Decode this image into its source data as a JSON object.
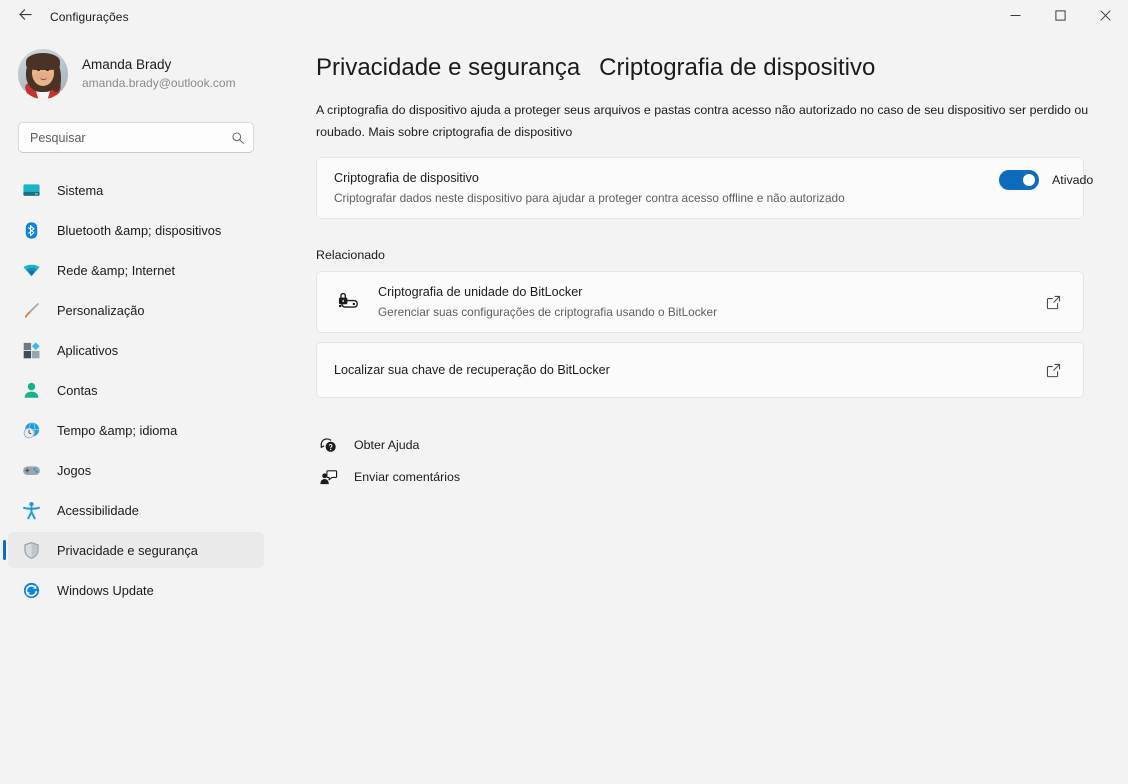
{
  "window": {
    "title": "Configurações",
    "back_icon": "back-arrow-icon",
    "minimize_label": "Minimizar",
    "maximize_label": "Maximizar",
    "close_label": "Fechar"
  },
  "account": {
    "name": "Amanda Brady",
    "email": "amanda.brady@outlook.com",
    "avatar_alt": "Amanda Brady"
  },
  "search": {
    "placeholder": "Pesquisar",
    "value": "",
    "icon": "search-icon"
  },
  "sidebar": {
    "items": [
      {
        "label": "Sistema",
        "icon": "monitor-icon",
        "selected": false
      },
      {
        "label": "Bluetooth &amp; dispositivos",
        "icon": "bluetooth-icon",
        "selected": false
      },
      {
        "label": "Rede &amp; Internet",
        "icon": "wifi-icon",
        "selected": false
      },
      {
        "label": "Personalização",
        "icon": "paintbrush-icon",
        "selected": false
      },
      {
        "label": "Aplicativos",
        "icon": "apps-icon",
        "selected": false
      },
      {
        "label": "Contas",
        "icon": "person-icon",
        "selected": false
      },
      {
        "label": "Tempo &amp; idioma",
        "icon": "clock-globe-icon",
        "selected": false
      },
      {
        "label": "Jogos",
        "icon": "gamepad-icon",
        "selected": false
      },
      {
        "label": "Acessibilidade",
        "icon": "accessibility-icon",
        "selected": false
      },
      {
        "label": "Privacidade e segurança",
        "icon": "shield-icon",
        "selected": true
      },
      {
        "label": "Windows Update",
        "icon": "update-icon",
        "selected": false
      }
    ]
  },
  "page": {
    "breadcrumb_parent": "Privacidade e segurança",
    "breadcrumb_current": "Criptografia de dispositivo",
    "description": "A criptografia do dispositivo ajuda a proteger seus arquivos e pastas contra acesso não autorizado no caso de seu dispositivo ser perdido ou roubado. Mais sobre criptografia de dispositivo"
  },
  "encryption_setting": {
    "title": "Criptografia de dispositivo",
    "subtitle": "Criptografar dados neste dispositivo para ajudar a proteger contra acesso offline e não autorizado",
    "toggle_state_label": "Ativado",
    "toggle_on": true,
    "accent_color": "#0F6CBD"
  },
  "related": {
    "heading": "Relacionado",
    "items": [
      {
        "title": "Criptografia de unidade do BitLocker",
        "subtitle": "Gerenciar suas configurações de criptografia usando o BitLocker",
        "icon": "bitlocker-drive-icon",
        "action_icon": "open-external-icon"
      },
      {
        "title": "Localizar sua chave de recuperação do BitLocker",
        "subtitle": "",
        "icon": "",
        "action_icon": "open-external-icon"
      }
    ]
  },
  "footer_links": [
    {
      "label": "Obter Ajuda",
      "icon": "help-icon"
    },
    {
      "label": "Enviar comentários",
      "icon": "feedback-icon"
    }
  ],
  "colors": {
    "page_background": "#F3F3F3",
    "card_background": "#FBFBFB",
    "accent": "#0F6CBD",
    "selected_nav_background": "#EAEAEA"
  }
}
